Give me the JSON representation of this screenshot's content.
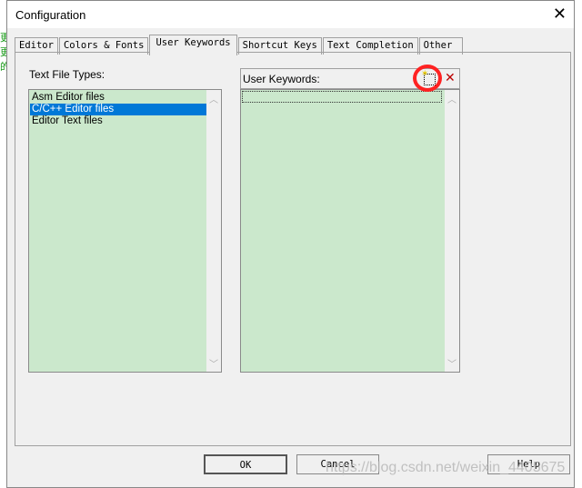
{
  "dialog": {
    "title": "Configuration"
  },
  "tabs": [
    "Editor",
    "Colors & Fonts",
    "User Keywords",
    "Shortcut Keys",
    "Text Completion",
    "Other"
  ],
  "active_tab": "User Keywords",
  "file_types": {
    "label": "Text File Types:",
    "items": [
      "Asm Editor files",
      "C/C++ Editor files",
      "Editor Text files"
    ],
    "selected": "C/C++ Editor files"
  },
  "keywords": {
    "label": "User Keywords:",
    "new_icon": "new-item-icon",
    "delete_icon": "delete-x-icon"
  },
  "buttons": {
    "ok": "OK",
    "cancel": "Cancel",
    "help": "Help"
  },
  "watermark": "https://blog.csdn.net/weixin_4405675",
  "colors": {
    "list_bg": "#cbe8cc",
    "selection": "#0078d7",
    "annotation": "#ff2020"
  }
}
